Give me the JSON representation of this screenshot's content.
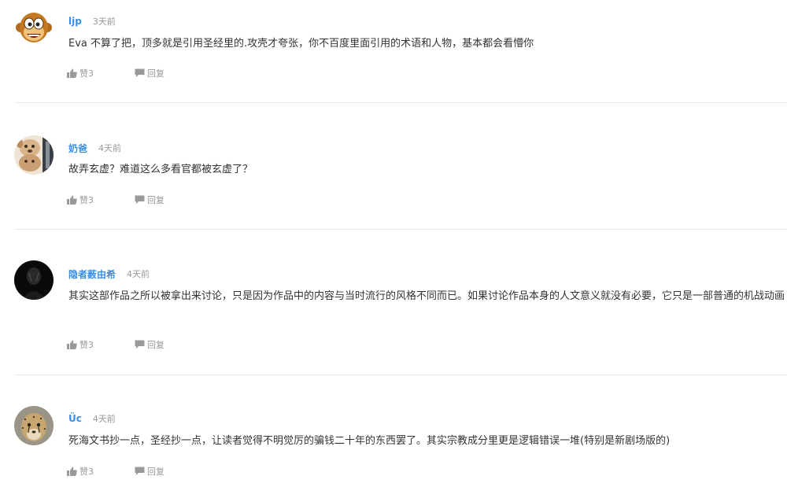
{
  "comments": [
    {
      "avatar": "cartoon-monkey-avatar",
      "username": "ljp",
      "time": "3天前",
      "text": "Eva 不算了把，顶多就是引用圣经里的.攻壳才夸张，你不百度里面引用的术语和人物，基本都会看懵你",
      "likes": "赞3",
      "reply": "回复"
    },
    {
      "avatar": "puppy-photo-avatar",
      "username": "奶爸",
      "time": "4天前",
      "text": "故弄玄虚？难道这么多看官都被玄虚了？",
      "likes": "赞3",
      "reply": "回复"
    },
    {
      "avatar": "dark-figure-avatar",
      "username": "隐者薮由希",
      "time": "4天前",
      "text": "其实这部作品之所以被拿出来讨论，只是因为作品中的内容与当时流行的风格不同而已。如果讨论作品本身的人文意义就没有必要，它只是一部普通的机战动画",
      "likes": "赞3",
      "reply": "回复"
    },
    {
      "avatar": "cheetah-photo-avatar",
      "username": "Üc",
      "time": "4天前",
      "text": "死海文书抄一点，圣经抄一点，让读者觉得不明觉厉的骗钱二十年的东西罢了。其实宗教成分里更是逻辑错误一堆(特别是新剧场版的)",
      "likes": "赞3",
      "reply": "回复"
    }
  ],
  "icons": {
    "like": "thumbs-up-icon",
    "reply": "speech-bubble-icon"
  },
  "colors": {
    "username": "#3a8ee6",
    "meta": "#999999",
    "text": "#333333",
    "divider": "#e8e8e8"
  }
}
